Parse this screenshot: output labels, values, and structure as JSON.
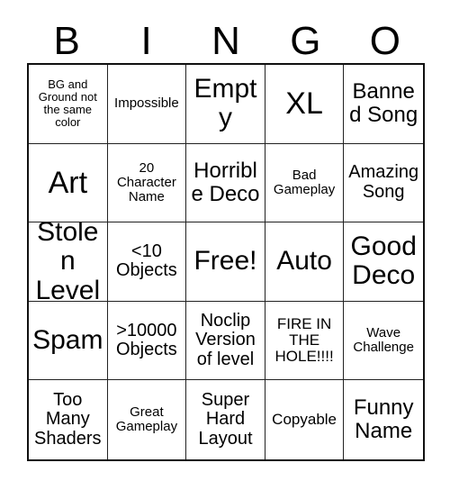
{
  "header": {
    "letters": [
      "B",
      "I",
      "N",
      "G",
      "O"
    ]
  },
  "grid": {
    "rows": 5,
    "columns": 5,
    "cells": [
      {
        "text": "BG and Ground not the same color",
        "size": "fs-xs"
      },
      {
        "text": "Impossible",
        "size": "fs-sm"
      },
      {
        "text": "Empty",
        "size": "fs-xxl"
      },
      {
        "text": "XL",
        "size": "fs-huge"
      },
      {
        "text": "Banned Song",
        "size": "fs-xl"
      },
      {
        "text": "Art",
        "size": "fs-huge"
      },
      {
        "text": "20 Character Name",
        "size": "fs-sm"
      },
      {
        "text": "Horrible Deco",
        "size": "fs-xl"
      },
      {
        "text": "Bad Gameplay",
        "size": "fs-sm"
      },
      {
        "text": "Amazing Song",
        "size": "fs-lg"
      },
      {
        "text": "Stolen Level",
        "size": "fs-xxl"
      },
      {
        "text": "<10 Objects",
        "size": "fs-lg"
      },
      {
        "text": "Free!",
        "size": "fs-xxl"
      },
      {
        "text": "Auto",
        "size": "fs-xxl"
      },
      {
        "text": "Good Deco",
        "size": "fs-xxl"
      },
      {
        "text": "Spam",
        "size": "fs-xxl"
      },
      {
        "text": ">10000 Objects",
        "size": "fs-lg"
      },
      {
        "text": "Noclip Version of level",
        "size": "fs-lg"
      },
      {
        "text": "FIRE IN THE HOLE!!!!",
        "size": "fs-md"
      },
      {
        "text": "Wave Challenge",
        "size": "fs-sm"
      },
      {
        "text": "Too Many Shaders",
        "size": "fs-lg"
      },
      {
        "text": "Great Gameplay",
        "size": "fs-sm"
      },
      {
        "text": "Super Hard Layout",
        "size": "fs-lg"
      },
      {
        "text": "Copyable",
        "size": "fs-md"
      },
      {
        "text": "Funny Name",
        "size": "fs-xl"
      }
    ]
  },
  "colors": {
    "background": "#ffffff",
    "text": "#000000",
    "grid_outer_border": "#111111",
    "grid_inner_border": "#222222"
  }
}
